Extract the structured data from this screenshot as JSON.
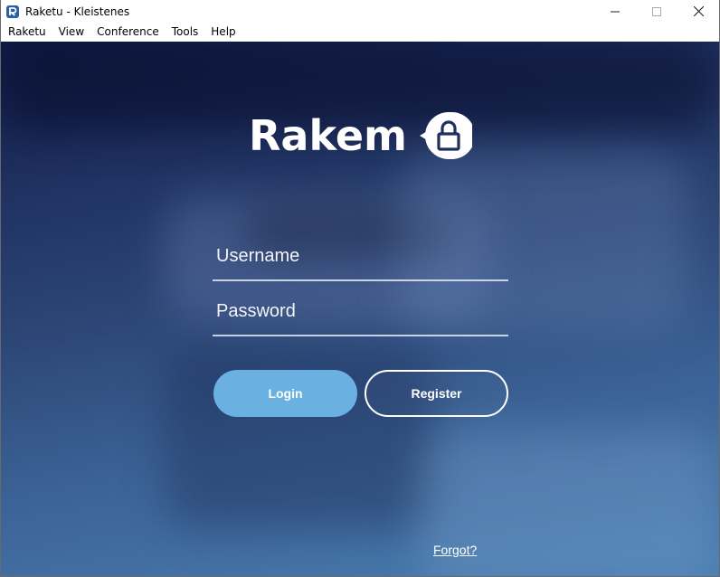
{
  "window": {
    "title": "Raketu - Kleistenes",
    "app_icon": "raketu-r-icon",
    "controls": {
      "minimize_icon": "minimize-icon",
      "maximize_icon": "maximize-icon",
      "close_icon": "close-icon"
    }
  },
  "menubar": {
    "items": [
      {
        "label": "Raketu"
      },
      {
        "label": "View"
      },
      {
        "label": "Conference"
      },
      {
        "label": "Tools"
      },
      {
        "label": "Help"
      }
    ]
  },
  "login": {
    "logo_text": "Rakem",
    "logo_icon": "lock-icon",
    "username": {
      "placeholder": "Username",
      "value": ""
    },
    "password": {
      "placeholder": "Password",
      "value": ""
    },
    "login_label": "Login",
    "register_label": "Register",
    "forgot_label": "Forgot?"
  },
  "colors": {
    "accent": "#6ab0e0",
    "background_top": "#0f1a44",
    "background_bottom": "#4a7eb1"
  }
}
